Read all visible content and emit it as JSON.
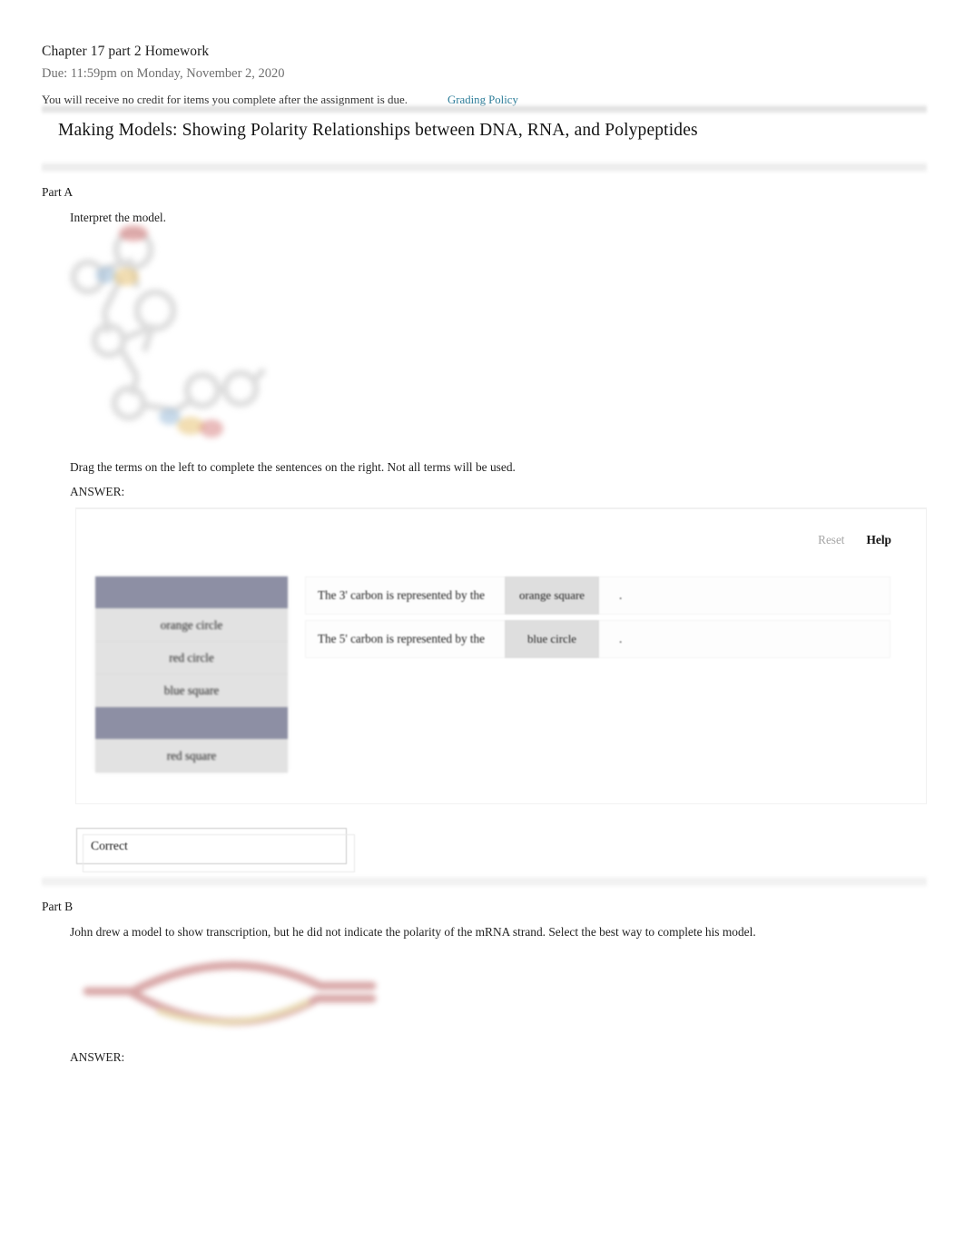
{
  "header": {
    "assignment_title": "Chapter 17 part 2 Homework",
    "due": "Due: 11:59pm on Monday, November 2, 2020",
    "credit_note": "You will receive no credit for items you complete after the assignment is due.",
    "grading_policy_link": "Grading Policy"
  },
  "section": {
    "title": "Making Models: Showing Polarity Relationships between DNA, RNA, and Polypeptides"
  },
  "part_a": {
    "label": "Part A",
    "intro": "Interpret the model.",
    "drag_instruction": "Drag the terms on the left to complete the sentences on the right. Not all terms will be used.",
    "answer_label": "ANSWER:",
    "toolbar": {
      "reset_label": "Reset",
      "help_label": "Help"
    },
    "term_bank": [
      {
        "label": "orange square",
        "state": "used"
      },
      {
        "label": "orange circle",
        "state": "available"
      },
      {
        "label": "red circle",
        "state": "available"
      },
      {
        "label": "blue square",
        "state": "available"
      },
      {
        "label": "blue circle",
        "state": "used"
      },
      {
        "label": "red square",
        "state": "available"
      }
    ],
    "sentences": [
      {
        "text": "The 3' carbon is represented by the",
        "answer": "orange square",
        "period": "."
      },
      {
        "text": "The 5' carbon is represented by the",
        "answer": "blue circle",
        "period": "."
      }
    ],
    "feedback": "Correct",
    "figure": {
      "name": "nucleotide-polarity-model",
      "description": "blurred faded molecular model of nucleotides with grey rings and colored marker highlights",
      "colors": {
        "ring": "#d9d9d9",
        "red": "#d06a6a",
        "blue": "#8fb4d6",
        "orange": "#e6c172"
      }
    }
  },
  "part_b": {
    "label": "Part B",
    "intro": "John drew a model to show transcription, but he did not indicate the polarity of the mRNA strand. Select the best way to complete his model.",
    "answer_label": "ANSWER:",
    "figure": {
      "name": "transcription-bubble-model",
      "description": "blurred transcription bubble with separated DNA strands and mRNA strand",
      "colors": {
        "dna": "#cf9292",
        "mrna": "#e4d2a4"
      }
    }
  }
}
